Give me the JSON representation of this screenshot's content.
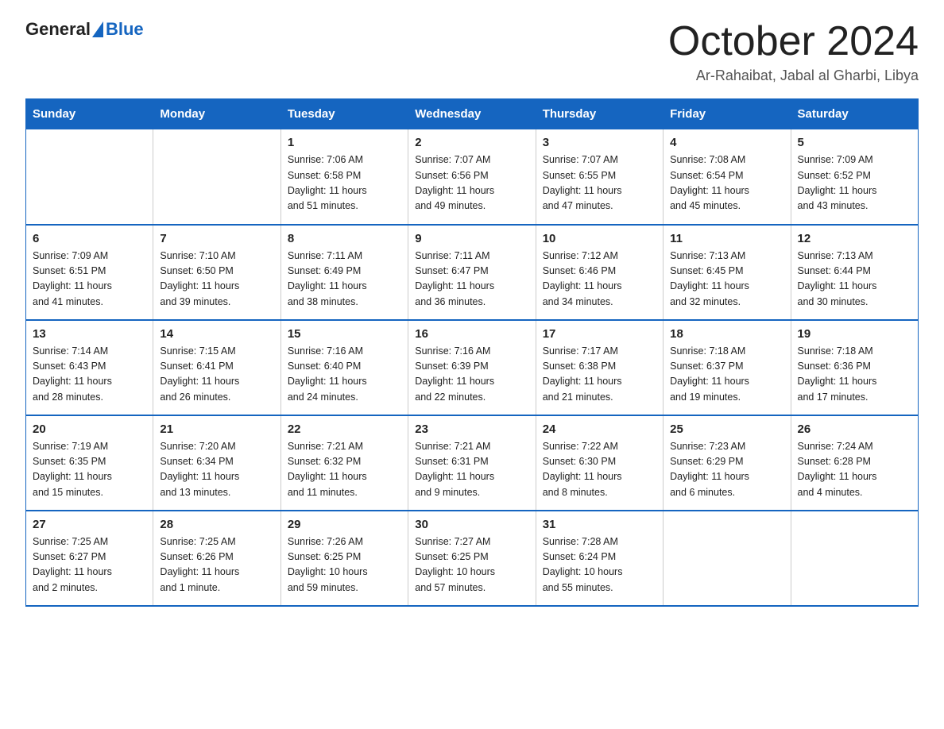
{
  "header": {
    "logo_general": "General",
    "logo_blue": "Blue",
    "title": "October 2024",
    "subtitle": "Ar-Rahaibat, Jabal al Gharbi, Libya"
  },
  "weekdays": [
    "Sunday",
    "Monday",
    "Tuesday",
    "Wednesday",
    "Thursday",
    "Friday",
    "Saturday"
  ],
  "weeks": [
    [
      {
        "day": "",
        "info": ""
      },
      {
        "day": "",
        "info": ""
      },
      {
        "day": "1",
        "info": "Sunrise: 7:06 AM\nSunset: 6:58 PM\nDaylight: 11 hours\nand 51 minutes."
      },
      {
        "day": "2",
        "info": "Sunrise: 7:07 AM\nSunset: 6:56 PM\nDaylight: 11 hours\nand 49 minutes."
      },
      {
        "day": "3",
        "info": "Sunrise: 7:07 AM\nSunset: 6:55 PM\nDaylight: 11 hours\nand 47 minutes."
      },
      {
        "day": "4",
        "info": "Sunrise: 7:08 AM\nSunset: 6:54 PM\nDaylight: 11 hours\nand 45 minutes."
      },
      {
        "day": "5",
        "info": "Sunrise: 7:09 AM\nSunset: 6:52 PM\nDaylight: 11 hours\nand 43 minutes."
      }
    ],
    [
      {
        "day": "6",
        "info": "Sunrise: 7:09 AM\nSunset: 6:51 PM\nDaylight: 11 hours\nand 41 minutes."
      },
      {
        "day": "7",
        "info": "Sunrise: 7:10 AM\nSunset: 6:50 PM\nDaylight: 11 hours\nand 39 minutes."
      },
      {
        "day": "8",
        "info": "Sunrise: 7:11 AM\nSunset: 6:49 PM\nDaylight: 11 hours\nand 38 minutes."
      },
      {
        "day": "9",
        "info": "Sunrise: 7:11 AM\nSunset: 6:47 PM\nDaylight: 11 hours\nand 36 minutes."
      },
      {
        "day": "10",
        "info": "Sunrise: 7:12 AM\nSunset: 6:46 PM\nDaylight: 11 hours\nand 34 minutes."
      },
      {
        "day": "11",
        "info": "Sunrise: 7:13 AM\nSunset: 6:45 PM\nDaylight: 11 hours\nand 32 minutes."
      },
      {
        "day": "12",
        "info": "Sunrise: 7:13 AM\nSunset: 6:44 PM\nDaylight: 11 hours\nand 30 minutes."
      }
    ],
    [
      {
        "day": "13",
        "info": "Sunrise: 7:14 AM\nSunset: 6:43 PM\nDaylight: 11 hours\nand 28 minutes."
      },
      {
        "day": "14",
        "info": "Sunrise: 7:15 AM\nSunset: 6:41 PM\nDaylight: 11 hours\nand 26 minutes."
      },
      {
        "day": "15",
        "info": "Sunrise: 7:16 AM\nSunset: 6:40 PM\nDaylight: 11 hours\nand 24 minutes."
      },
      {
        "day": "16",
        "info": "Sunrise: 7:16 AM\nSunset: 6:39 PM\nDaylight: 11 hours\nand 22 minutes."
      },
      {
        "day": "17",
        "info": "Sunrise: 7:17 AM\nSunset: 6:38 PM\nDaylight: 11 hours\nand 21 minutes."
      },
      {
        "day": "18",
        "info": "Sunrise: 7:18 AM\nSunset: 6:37 PM\nDaylight: 11 hours\nand 19 minutes."
      },
      {
        "day": "19",
        "info": "Sunrise: 7:18 AM\nSunset: 6:36 PM\nDaylight: 11 hours\nand 17 minutes."
      }
    ],
    [
      {
        "day": "20",
        "info": "Sunrise: 7:19 AM\nSunset: 6:35 PM\nDaylight: 11 hours\nand 15 minutes."
      },
      {
        "day": "21",
        "info": "Sunrise: 7:20 AM\nSunset: 6:34 PM\nDaylight: 11 hours\nand 13 minutes."
      },
      {
        "day": "22",
        "info": "Sunrise: 7:21 AM\nSunset: 6:32 PM\nDaylight: 11 hours\nand 11 minutes."
      },
      {
        "day": "23",
        "info": "Sunrise: 7:21 AM\nSunset: 6:31 PM\nDaylight: 11 hours\nand 9 minutes."
      },
      {
        "day": "24",
        "info": "Sunrise: 7:22 AM\nSunset: 6:30 PM\nDaylight: 11 hours\nand 8 minutes."
      },
      {
        "day": "25",
        "info": "Sunrise: 7:23 AM\nSunset: 6:29 PM\nDaylight: 11 hours\nand 6 minutes."
      },
      {
        "day": "26",
        "info": "Sunrise: 7:24 AM\nSunset: 6:28 PM\nDaylight: 11 hours\nand 4 minutes."
      }
    ],
    [
      {
        "day": "27",
        "info": "Sunrise: 7:25 AM\nSunset: 6:27 PM\nDaylight: 11 hours\nand 2 minutes."
      },
      {
        "day": "28",
        "info": "Sunrise: 7:25 AM\nSunset: 6:26 PM\nDaylight: 11 hours\nand 1 minute."
      },
      {
        "day": "29",
        "info": "Sunrise: 7:26 AM\nSunset: 6:25 PM\nDaylight: 10 hours\nand 59 minutes."
      },
      {
        "day": "30",
        "info": "Sunrise: 7:27 AM\nSunset: 6:25 PM\nDaylight: 10 hours\nand 57 minutes."
      },
      {
        "day": "31",
        "info": "Sunrise: 7:28 AM\nSunset: 6:24 PM\nDaylight: 10 hours\nand 55 minutes."
      },
      {
        "day": "",
        "info": ""
      },
      {
        "day": "",
        "info": ""
      }
    ]
  ]
}
